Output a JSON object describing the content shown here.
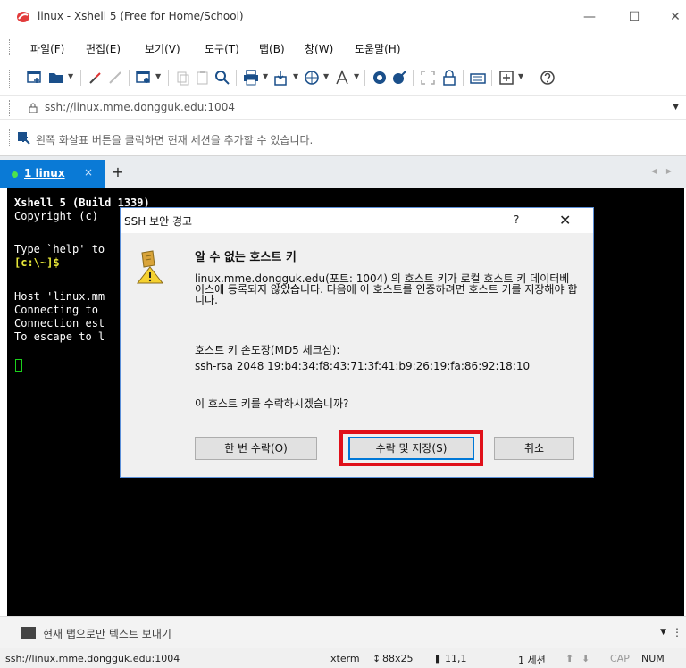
{
  "window": {
    "title": "linux - Xshell 5 (Free for Home/School)",
    "minimize": "—",
    "maximize": "☐",
    "close": "✕"
  },
  "menu": {
    "items": [
      "파일(F)",
      "편집(E)",
      "보기(V)",
      "도구(T)",
      "탭(B)",
      "창(W)",
      "도움말(H)"
    ]
  },
  "address": {
    "url": "ssh://linux.mme.dongguk.edu:1004"
  },
  "hint": {
    "text": "왼쪽 화살표 버튼을 클릭하면 현재 세션을 추가할 수 있습니다."
  },
  "tabs": {
    "active_label": "1 linux",
    "close": "×",
    "add": "+",
    "nav": "◀ ▶"
  },
  "terminal": {
    "lines": [
      "Xshell 5 (Build 1339)",
      "Copyright (c)",
      "",
      "Type `help' to",
      "[c:\\~]$",
      "",
      "Host 'linux.mm",
      "Connecting to",
      "Connection est",
      "To escape to l"
    ]
  },
  "dialog": {
    "title": "SSH 보안 경고",
    "help": "?",
    "close": "✕",
    "heading": "알 수 없는 호스트 키",
    "message": "linux.mme.dongguk.edu(포트: 1004) 의 호스트 키가 로컬 호스트 키 데이터베이스에 등록되지 않았습니다. 다음에 이 호스트를 인증하려면 호스트 키를 저장해야 합니다.",
    "fingerprint_label": "호스트 키 손도장(MD5 체크섬):",
    "fingerprint_value": "ssh-rsa 2048 19:b4:34:f8:43:71:3f:41:b9:26:19:fa:86:92:18:10",
    "question": "이 호스트 키를 수락하시겠습니까?",
    "buttons": {
      "accept_once": "한 번 수락(O)",
      "accept_save": "수락 및 저장(S)",
      "cancel": "취소"
    }
  },
  "sendbar": {
    "text": "현재 탭으로만 텍스트 보내기",
    "more": "⋮"
  },
  "status": {
    "connection": "ssh://linux.mme.dongguk.edu:1004",
    "terminal_type": "xterm",
    "size": "88x25",
    "cursor_pos": "11,1",
    "sessions": "1 세션",
    "cap": "CAP",
    "num": "NUM"
  },
  "colors": {
    "tab_active": "#0a7ad6",
    "highlight": "#e0101a",
    "terminal_bg": "#000000",
    "prompt": "#e8e839",
    "cursor": "#1cd11c"
  }
}
